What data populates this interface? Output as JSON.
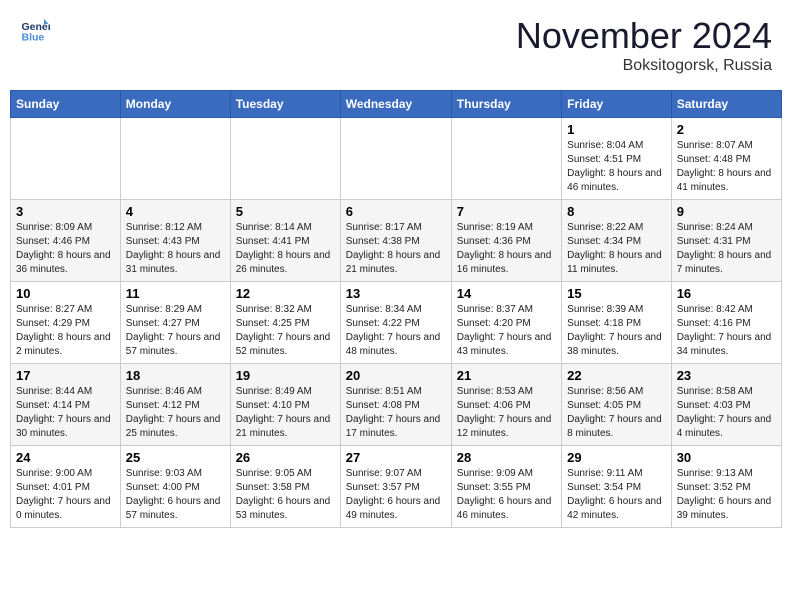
{
  "logo": {
    "line1": "General",
    "line2": "Blue"
  },
  "title": "November 2024",
  "location": "Boksitogorsk, Russia",
  "days_of_week": [
    "Sunday",
    "Monday",
    "Tuesday",
    "Wednesday",
    "Thursday",
    "Friday",
    "Saturday"
  ],
  "weeks": [
    [
      {
        "day": "",
        "info": ""
      },
      {
        "day": "",
        "info": ""
      },
      {
        "day": "",
        "info": ""
      },
      {
        "day": "",
        "info": ""
      },
      {
        "day": "",
        "info": ""
      },
      {
        "day": "1",
        "info": "Sunrise: 8:04 AM\nSunset: 4:51 PM\nDaylight: 8 hours and 46 minutes."
      },
      {
        "day": "2",
        "info": "Sunrise: 8:07 AM\nSunset: 4:48 PM\nDaylight: 8 hours and 41 minutes."
      }
    ],
    [
      {
        "day": "3",
        "info": "Sunrise: 8:09 AM\nSunset: 4:46 PM\nDaylight: 8 hours and 36 minutes."
      },
      {
        "day": "4",
        "info": "Sunrise: 8:12 AM\nSunset: 4:43 PM\nDaylight: 8 hours and 31 minutes."
      },
      {
        "day": "5",
        "info": "Sunrise: 8:14 AM\nSunset: 4:41 PM\nDaylight: 8 hours and 26 minutes."
      },
      {
        "day": "6",
        "info": "Sunrise: 8:17 AM\nSunset: 4:38 PM\nDaylight: 8 hours and 21 minutes."
      },
      {
        "day": "7",
        "info": "Sunrise: 8:19 AM\nSunset: 4:36 PM\nDaylight: 8 hours and 16 minutes."
      },
      {
        "day": "8",
        "info": "Sunrise: 8:22 AM\nSunset: 4:34 PM\nDaylight: 8 hours and 11 minutes."
      },
      {
        "day": "9",
        "info": "Sunrise: 8:24 AM\nSunset: 4:31 PM\nDaylight: 8 hours and 7 minutes."
      }
    ],
    [
      {
        "day": "10",
        "info": "Sunrise: 8:27 AM\nSunset: 4:29 PM\nDaylight: 8 hours and 2 minutes."
      },
      {
        "day": "11",
        "info": "Sunrise: 8:29 AM\nSunset: 4:27 PM\nDaylight: 7 hours and 57 minutes."
      },
      {
        "day": "12",
        "info": "Sunrise: 8:32 AM\nSunset: 4:25 PM\nDaylight: 7 hours and 52 minutes."
      },
      {
        "day": "13",
        "info": "Sunrise: 8:34 AM\nSunset: 4:22 PM\nDaylight: 7 hours and 48 minutes."
      },
      {
        "day": "14",
        "info": "Sunrise: 8:37 AM\nSunset: 4:20 PM\nDaylight: 7 hours and 43 minutes."
      },
      {
        "day": "15",
        "info": "Sunrise: 8:39 AM\nSunset: 4:18 PM\nDaylight: 7 hours and 38 minutes."
      },
      {
        "day": "16",
        "info": "Sunrise: 8:42 AM\nSunset: 4:16 PM\nDaylight: 7 hours and 34 minutes."
      }
    ],
    [
      {
        "day": "17",
        "info": "Sunrise: 8:44 AM\nSunset: 4:14 PM\nDaylight: 7 hours and 30 minutes."
      },
      {
        "day": "18",
        "info": "Sunrise: 8:46 AM\nSunset: 4:12 PM\nDaylight: 7 hours and 25 minutes."
      },
      {
        "day": "19",
        "info": "Sunrise: 8:49 AM\nSunset: 4:10 PM\nDaylight: 7 hours and 21 minutes."
      },
      {
        "day": "20",
        "info": "Sunrise: 8:51 AM\nSunset: 4:08 PM\nDaylight: 7 hours and 17 minutes."
      },
      {
        "day": "21",
        "info": "Sunrise: 8:53 AM\nSunset: 4:06 PM\nDaylight: 7 hours and 12 minutes."
      },
      {
        "day": "22",
        "info": "Sunrise: 8:56 AM\nSunset: 4:05 PM\nDaylight: 7 hours and 8 minutes."
      },
      {
        "day": "23",
        "info": "Sunrise: 8:58 AM\nSunset: 4:03 PM\nDaylight: 7 hours and 4 minutes."
      }
    ],
    [
      {
        "day": "24",
        "info": "Sunrise: 9:00 AM\nSunset: 4:01 PM\nDaylight: 7 hours and 0 minutes."
      },
      {
        "day": "25",
        "info": "Sunrise: 9:03 AM\nSunset: 4:00 PM\nDaylight: 6 hours and 57 minutes."
      },
      {
        "day": "26",
        "info": "Sunrise: 9:05 AM\nSunset: 3:58 PM\nDaylight: 6 hours and 53 minutes."
      },
      {
        "day": "27",
        "info": "Sunrise: 9:07 AM\nSunset: 3:57 PM\nDaylight: 6 hours and 49 minutes."
      },
      {
        "day": "28",
        "info": "Sunrise: 9:09 AM\nSunset: 3:55 PM\nDaylight: 6 hours and 46 minutes."
      },
      {
        "day": "29",
        "info": "Sunrise: 9:11 AM\nSunset: 3:54 PM\nDaylight: 6 hours and 42 minutes."
      },
      {
        "day": "30",
        "info": "Sunrise: 9:13 AM\nSunset: 3:52 PM\nDaylight: 6 hours and 39 minutes."
      }
    ]
  ]
}
